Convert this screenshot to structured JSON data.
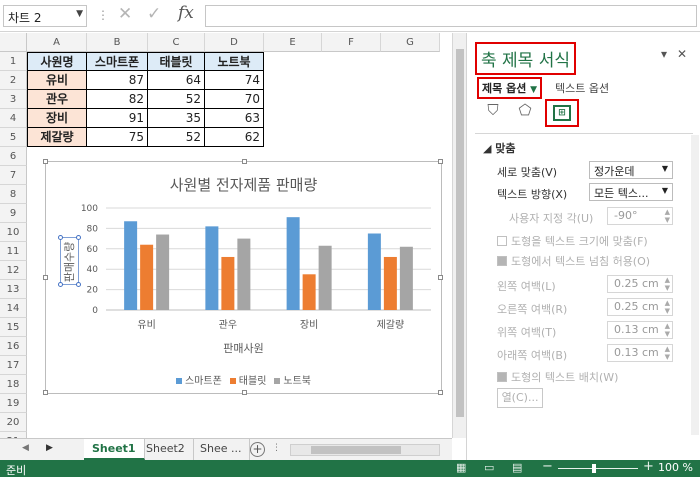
{
  "formula_bar": {
    "name_box": "차트 2",
    "formula": ""
  },
  "sheet": {
    "columns": [
      "A",
      "B",
      "C",
      "D",
      "E",
      "F",
      "G"
    ],
    "rows": [
      "1",
      "2",
      "3",
      "4",
      "5",
      "6",
      "7",
      "8",
      "9",
      "10",
      "11",
      "12",
      "13",
      "14",
      "15",
      "16",
      "17",
      "18",
      "19",
      "20",
      "21"
    ],
    "table": {
      "header": [
        "사원명",
        "스마트폰",
        "태블릿",
        "노트북"
      ],
      "rows": [
        [
          "유비",
          "87",
          "64",
          "74"
        ],
        [
          "관우",
          "82",
          "52",
          "70"
        ],
        [
          "장비",
          "91",
          "35",
          "63"
        ],
        [
          "제갈량",
          "75",
          "52",
          "62"
        ]
      ]
    }
  },
  "chart_data": {
    "type": "bar",
    "title": "사원별 전자제품 판매량",
    "xlabel": "판매사원",
    "ylabel": "판매수량",
    "categories": [
      "유비",
      "관우",
      "장비",
      "제갈량"
    ],
    "series": [
      {
        "name": "스마트폰",
        "values": [
          87,
          82,
          91,
          75
        ],
        "color": "#5b9bd5"
      },
      {
        "name": "태블릿",
        "values": [
          64,
          52,
          35,
          52
        ],
        "color": "#ed7d31"
      },
      {
        "name": "노트북",
        "values": [
          74,
          70,
          63,
          62
        ],
        "color": "#a5a5a5"
      }
    ],
    "yticks": [
      "0",
      "20",
      "40",
      "60",
      "80",
      "100"
    ],
    "ylim": [
      0,
      100
    ],
    "grid": true,
    "legend": "bottom"
  },
  "tabs": {
    "items": [
      "Sheet1",
      "Sheet2",
      "Shee ..."
    ],
    "active": "Sheet1"
  },
  "status": {
    "ready": "준비",
    "zoom": "100 %",
    "zoom_minus": "−",
    "zoom_plus": "+"
  },
  "pane": {
    "title": "축 제목 서식",
    "tab_title_options": "제목 옵션",
    "tab_text_options": "텍스트 옵션",
    "section": "맞춤",
    "vertical_align_label": "세로 맞춤(V)",
    "vertical_align_value": "정가운데",
    "text_direction_label": "텍스트 방향(X)",
    "text_direction_value": "모든 텍스...",
    "custom_angle_label": "사용자 지정 각(U)",
    "custom_angle_value": "-90°",
    "resize_shape_label": "도형을 텍스트 크기에 맞춤(F)",
    "overflow_label": "도형에서 텍스트 넘침 허용(O)",
    "left_margin_label": "왼쪽 여백(L)",
    "left_margin_value": "0.25 cm",
    "right_margin_label": "오른쪽 여백(R)",
    "right_margin_value": "0.25 cm",
    "top_margin_label": "위쪽 여백(T)",
    "top_margin_value": "0.13 cm",
    "bottom_margin_label": "아래쪽 여백(B)",
    "bottom_margin_value": "0.13 cm",
    "wrap_label": "도형의 텍스트 배치(W)",
    "columns_button": "열(C)..."
  },
  "colors": {
    "excel_green": "#217346",
    "highlight_red": "#e00000"
  },
  "icons": [
    "cancel-icon",
    "enter-icon",
    "fx-icon",
    "fill-line-icon",
    "effects-icon",
    "size-properties-icon",
    "close-icon",
    "pin-icon"
  ]
}
